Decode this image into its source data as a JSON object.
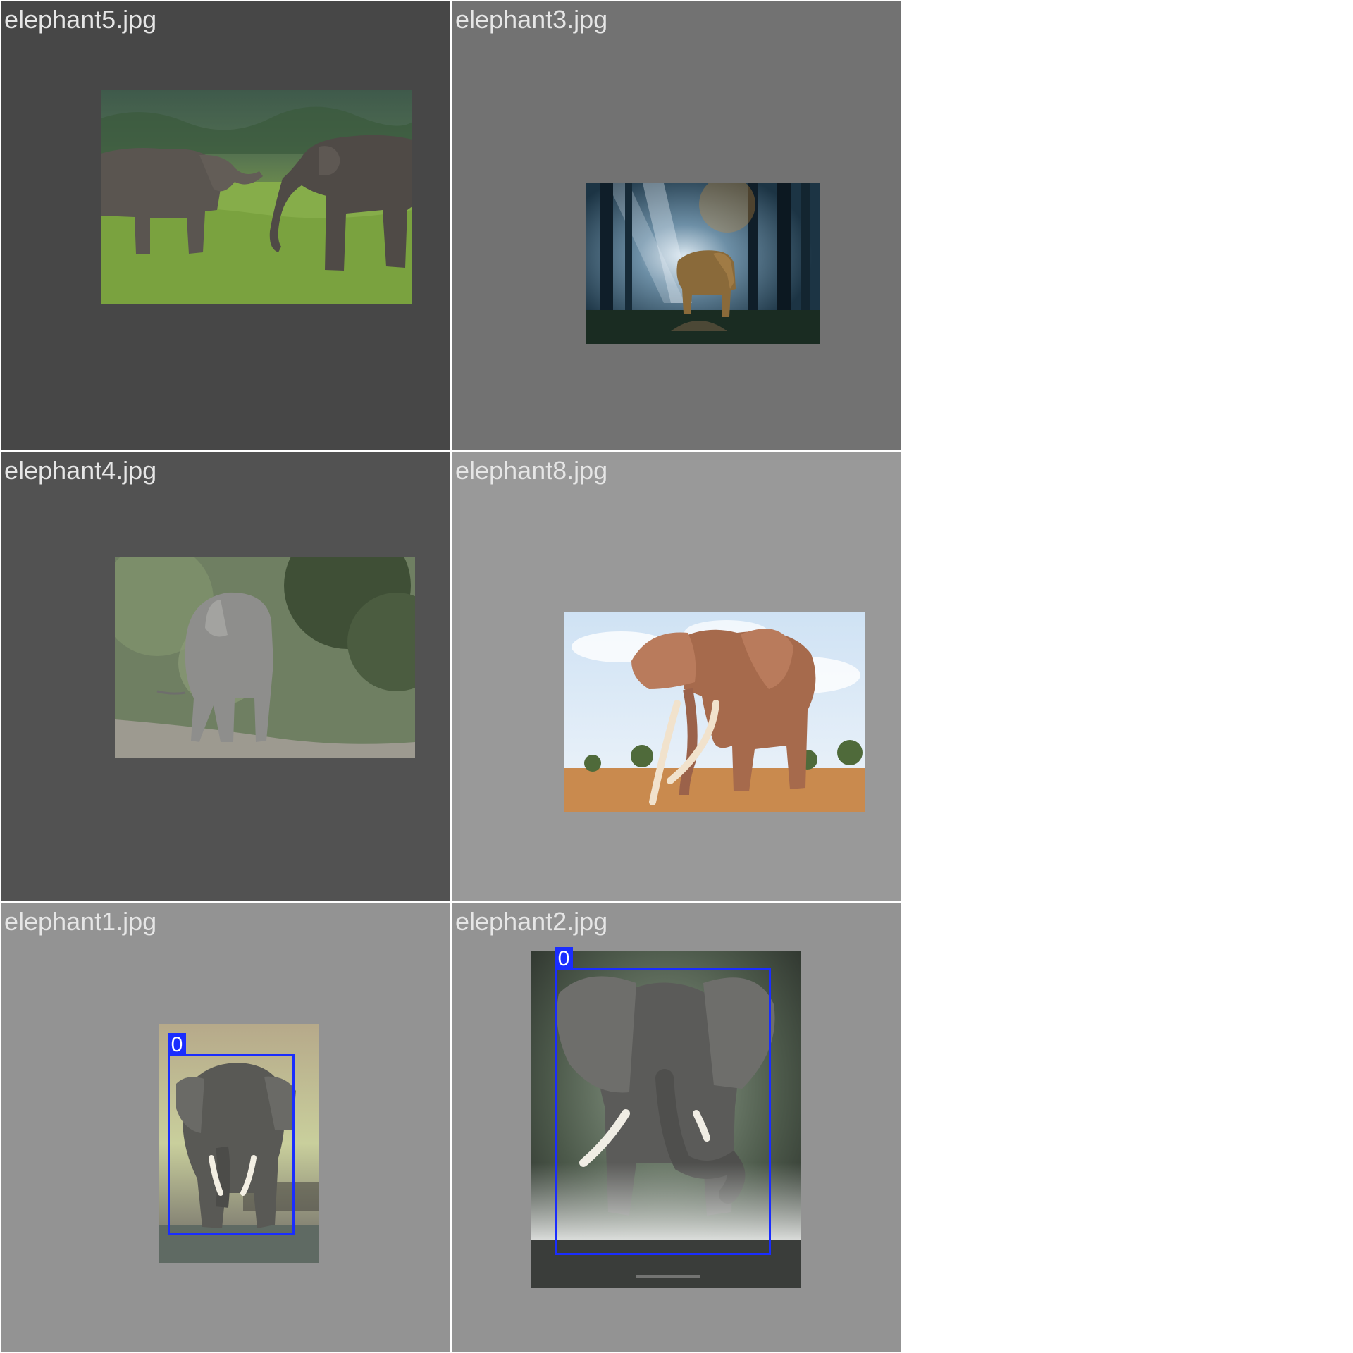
{
  "tiles": [
    {
      "label": "elephant5.jpg",
      "background": "#474747",
      "scene": "grassland-pair",
      "detections": []
    },
    {
      "label": "elephant3.jpg",
      "background": "#727272",
      "scene": "forest-light",
      "detections": []
    },
    {
      "label": "elephant4.jpg",
      "background": "#525252",
      "scene": "jungle-walk",
      "detections": []
    },
    {
      "label": "elephant8.jpg",
      "background": "#999999",
      "scene": "savanna-tusker",
      "detections": []
    },
    {
      "label": "elephant1.jpg",
      "background": "#939393",
      "scene": "water-tusker",
      "detections": [
        {
          "class_label": "0",
          "color": "#1a2dff"
        }
      ]
    },
    {
      "label": "elephant2.jpg",
      "background": "#939393",
      "scene": "bw-portrait",
      "detections": [
        {
          "class_label": "0",
          "color": "#1a2dff"
        }
      ]
    }
  ]
}
